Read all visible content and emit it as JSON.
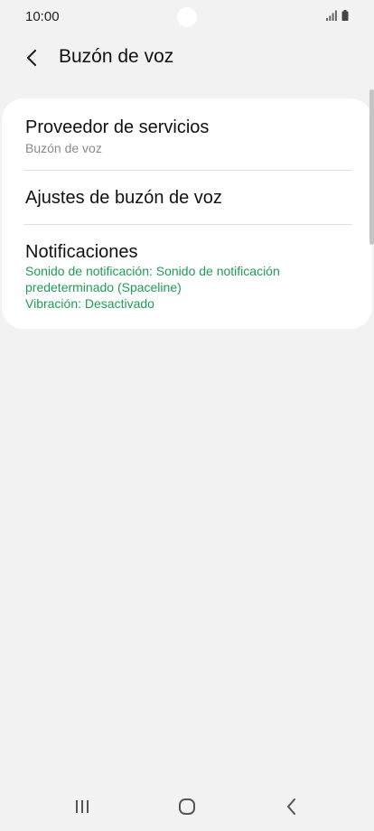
{
  "status_bar": {
    "time": "10:00",
    "icons": [
      "signal-icon",
      "battery-icon"
    ]
  },
  "header": {
    "back_icon": "arrow-left-icon",
    "title": "Buzón de voz"
  },
  "settings": {
    "items": [
      {
        "title": "Proveedor de servicios",
        "subtitle": "Buzón de voz"
      },
      {
        "title": "Ajustes de buzón de voz"
      },
      {
        "title": "Notificaciones",
        "detail_lines": [
          "Sonido de notificación: Sonido de notificación",
          "predeterminado (Spaceline)",
          "Vibración: Desactivado"
        ]
      }
    ]
  },
  "nav_bar": {
    "icons": [
      "recent-apps-icon",
      "home-icon",
      "back-icon"
    ]
  },
  "colors": {
    "background": "#f2f2f2",
    "card": "#ffffff",
    "accent_green": "#1e9b59",
    "subtitle_gray": "#8a8a8a"
  }
}
